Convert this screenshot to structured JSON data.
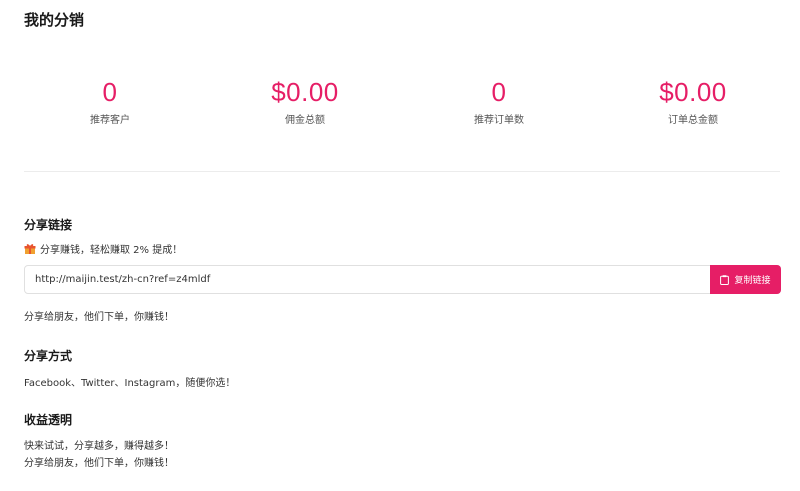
{
  "page": {
    "title": "我的分销"
  },
  "stats": [
    {
      "value": "0",
      "label": "推荐客户"
    },
    {
      "value": "$0.00",
      "label": "佣金总额"
    },
    {
      "value": "0",
      "label": "推荐订单数"
    },
    {
      "value": "$0.00",
      "label": "订单总金额"
    }
  ],
  "share_link": {
    "heading": "分享链接",
    "promo_text": "分享赚钱，轻松赚取 2% 提成！",
    "promo_icon": "gift-icon",
    "url": "http://maijin.test/zh-cn?ref=z4mldf",
    "copy_label": "复制链接",
    "copy_icon": "clipboard-icon",
    "note": "分享给朋友，他们下单，你赚钱！"
  },
  "share_methods": {
    "heading": "分享方式",
    "text": "Facebook、Twitter、Instagram，随便你选！"
  },
  "earnings": {
    "heading": "收益透明",
    "lines": [
      "快来试试，分享越多，赚得越多！",
      "分享给朋友，他们下单，你赚钱！"
    ]
  },
  "colors": {
    "accent": "#e61e66"
  }
}
